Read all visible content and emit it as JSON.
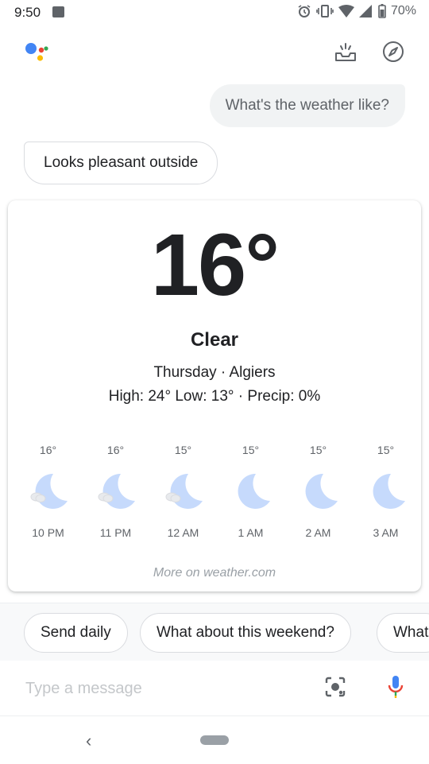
{
  "status_bar": {
    "time": "9:50",
    "battery": "70%"
  },
  "header": {
    "logo_icon": "google-assistant-logo",
    "inbox_icon": "updates-tray-icon",
    "explore_icon": "compass-icon"
  },
  "chat": {
    "user_message": "What's the weather like?",
    "assistant_message": "Looks pleasant outside"
  },
  "weather": {
    "temperature": "16°",
    "condition": "Clear",
    "day_location": "Thursday · Algiers",
    "high_low_precip": "High: 24° Low: 13° · Precip: 0%",
    "hourly": [
      {
        "temp": "16°",
        "time": "10 PM",
        "icon": "moon-cloud-icon"
      },
      {
        "temp": "16°",
        "time": "11 PM",
        "icon": "moon-cloud-icon"
      },
      {
        "temp": "15°",
        "time": "12 AM",
        "icon": "moon-cloud-icon"
      },
      {
        "temp": "15°",
        "time": "1 AM",
        "icon": "moon-icon"
      },
      {
        "temp": "15°",
        "time": "2 AM",
        "icon": "moon-icon"
      },
      {
        "temp": "15°",
        "time": "3 AM",
        "icon": "moon-icon"
      }
    ],
    "more_link": "More on weather.com"
  },
  "suggestions": [
    "Send daily",
    "What about this weekend?",
    "What"
  ],
  "input": {
    "placeholder": "Type a message"
  },
  "colors": {
    "moon": "#c6dafc",
    "google_blue": "#4285f4",
    "google_red": "#ea4335",
    "google_yellow": "#fbbc05",
    "google_green": "#34a853"
  }
}
